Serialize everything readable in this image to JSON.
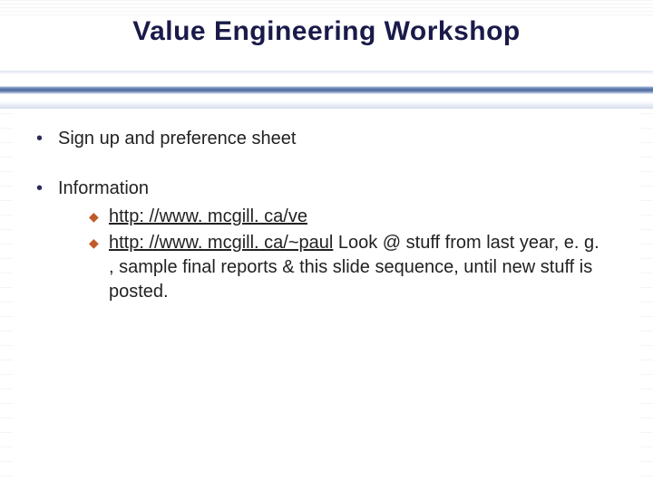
{
  "title": "Value Engineering Workshop",
  "bullets": {
    "b1": "Sign up and preference sheet",
    "b2": "Information"
  },
  "sub": {
    "link1": "http: //www. mcgill. ca/ve",
    "link2": "http: //www. mcgill. ca/~paul",
    "tail2": " Look @ stuff from last year, e. g. , sample final reports & this slide sequence, until new stuff is posted."
  }
}
